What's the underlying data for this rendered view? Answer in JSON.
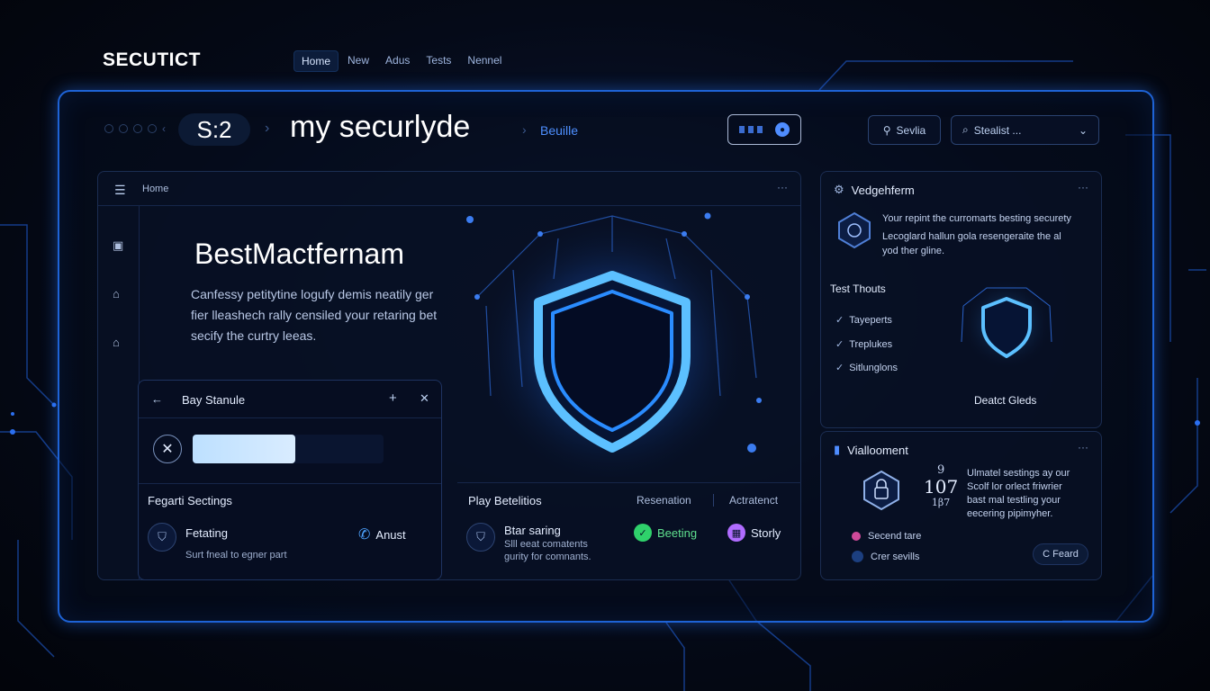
{
  "brand": {
    "logo": "SECUTICT"
  },
  "topnav": [
    "Home",
    "New",
    "Adus",
    "Tests",
    "Nennel"
  ],
  "header": {
    "counter": "S:2",
    "title": "my securlyde",
    "breadcrumb_sub": "Beuille",
    "secondary_button": "Sevlia",
    "search_select": "Stealist ..."
  },
  "main_panel": {
    "header_label": "Home",
    "hero_title": "BestMactfernam",
    "hero_desc": "Canfessy petitytine logufy demis neatily ger fier lleashech rally censiled your retaring bet secify the curtry leeas."
  },
  "sub_card": {
    "title": "Bay Stanule",
    "section_label": "Fegarti Sectings",
    "row_title": "Fetating",
    "row_sub": "Surt fneal to egner part",
    "action_label": "Anust"
  },
  "lower": {
    "section_label": "Play Betelitios",
    "tab1": "Resenation",
    "tab2": "Actratenct",
    "row_title": "Btar saring",
    "row_sub1": "Slll eeat comatents",
    "row_sub2": "gurity for comnants.",
    "action1": "Beeting",
    "action2": "Storly"
  },
  "right_panel_1": {
    "title": "Vedgehferm",
    "text_line1": "Your repint the curromarts besting securety",
    "text_line2": "Lecoglard hallun gola resengeraite the al",
    "text_line3": "yod ther gline.",
    "section_label": "Test Thouts",
    "checks": [
      "Tayeperts",
      "Treplukes",
      "Sitlunglons"
    ],
    "shield_label": "Deatct Gleds"
  },
  "right_panel_2": {
    "title": "Viallooment",
    "stat_top": "9",
    "stat_main": "107",
    "stat_bottom": "1β7",
    "text_line1": "Ulmatel sestings ay our",
    "text_line2": "Scolf lor orlect friwrier",
    "text_line3": "bast mal testling your",
    "text_line4": "eecering pipimyher.",
    "legend1": "Secend tare",
    "legend2": "Crer sevills",
    "button": "C Feard"
  },
  "colors": {
    "accent": "#1e63d6",
    "shield_glow": "#3aa0ff",
    "green_action": "#2fd16b",
    "purple_action": "#b06cff",
    "pink_legend": "#d04a9a",
    "blue_legend": "#1c3f80"
  }
}
